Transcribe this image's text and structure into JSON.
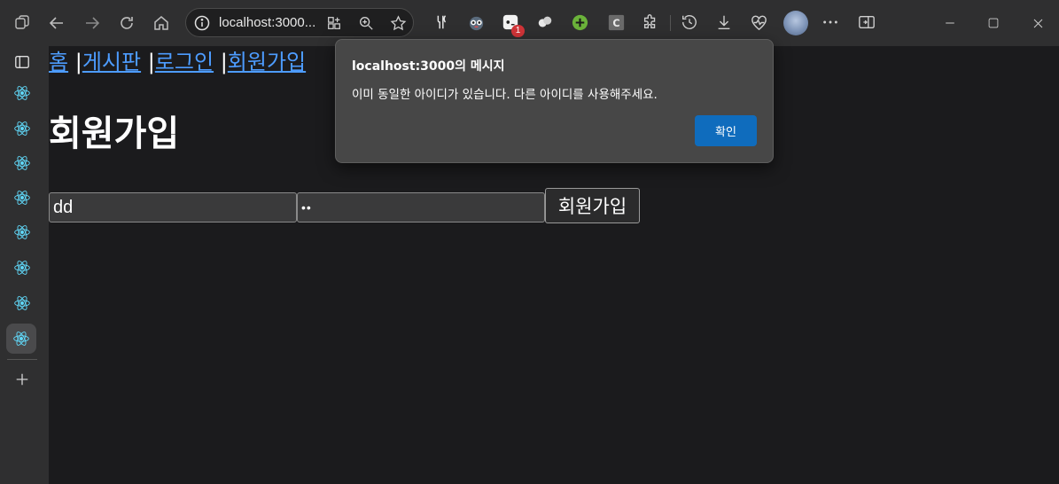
{
  "browser": {
    "address": "localhost:3000...",
    "badge_count": "1",
    "icons": {
      "tab_actions": "tab-actions-icon",
      "back": "back-arrow-icon",
      "forward": "forward-arrow-icon",
      "refresh": "refresh-icon",
      "home": "home-icon",
      "site_info": "info-icon",
      "app_available": "app-grid-icon",
      "zoom": "zoom-icon",
      "favorite": "star-icon",
      "extensions": "puzzle-icon",
      "history": "history-icon",
      "downloads": "download-icon",
      "performance": "heartbeat-icon",
      "more": "more-icon",
      "split_screen": "split-screen-icon"
    }
  },
  "sidebar": {
    "tabs": [
      {
        "icon": "react-icon"
      },
      {
        "icon": "react-icon"
      },
      {
        "icon": "react-icon"
      },
      {
        "icon": "react-icon"
      },
      {
        "icon": "react-icon"
      },
      {
        "icon": "react-icon"
      },
      {
        "icon": "react-icon"
      },
      {
        "icon": "react-icon",
        "active": true
      }
    ],
    "add_icon": "plus-icon"
  },
  "nav": {
    "home": "홈",
    "board": "게시판",
    "login": "로그인",
    "signup": "회원가입",
    "separator": "|"
  },
  "page": {
    "title": "회원가입",
    "username_value": "dd",
    "password_value": "••",
    "submit_label": "회원가입"
  },
  "dialog": {
    "title": "localhost:3000의 메시지",
    "message": "이미 동일한 아이디가 있습니다. 다른 아이디를 사용해주세요.",
    "ok_label": "확인"
  },
  "colors": {
    "page_bg": "#1b1b1d",
    "chrome_bg": "#2f2f30",
    "link": "#4d9cff",
    "dialog_bg": "#474747",
    "primary_button": "#0f6cbd",
    "badge": "#d13438"
  }
}
